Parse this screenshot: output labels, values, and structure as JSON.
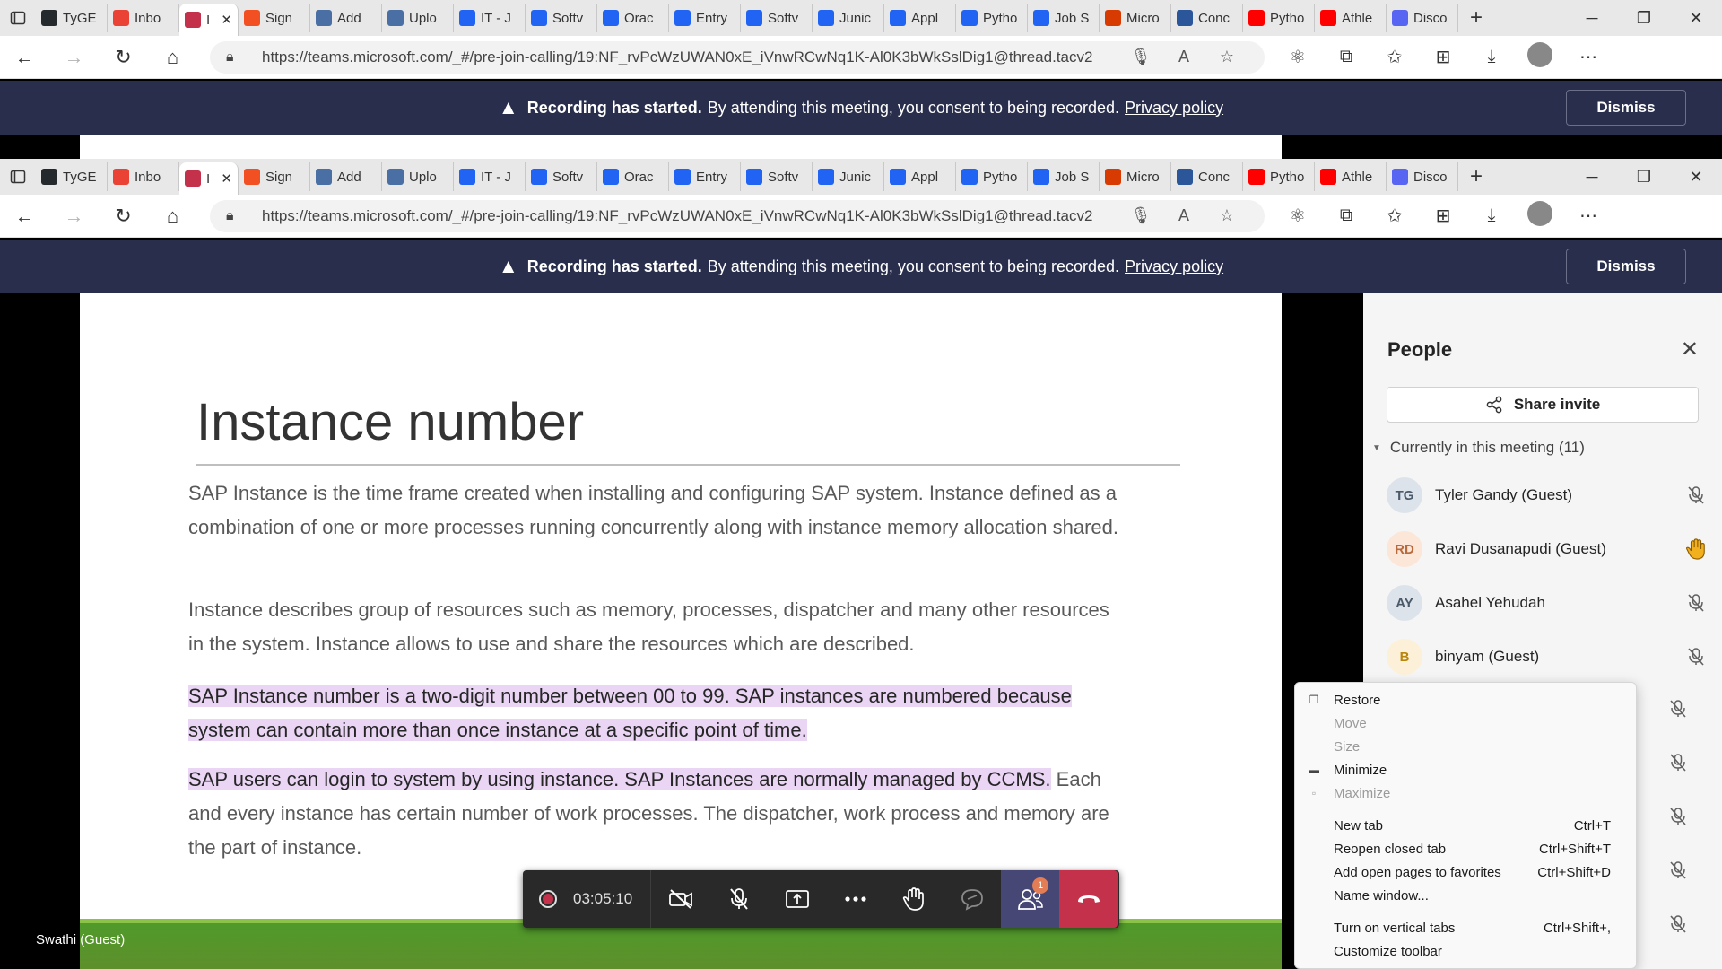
{
  "browser": {
    "tabs": [
      {
        "title": "TyGE",
        "favicon": "github-icon",
        "color": "#24292e"
      },
      {
        "title": "Inbo",
        "favicon": "gmail-icon",
        "color": "#ea4335"
      },
      {
        "title": "I",
        "favicon": "record-icon",
        "color": "#c4314b",
        "active": true
      },
      {
        "title": "Sign",
        "favicon": "microsoft-icon",
        "color": "#f25022"
      },
      {
        "title": "Add",
        "favicon": "page-icon",
        "color": "#4a6fa5"
      },
      {
        "title": "Uplo",
        "favicon": "page-icon",
        "color": "#4a6fa5"
      },
      {
        "title": "IT - J",
        "favicon": "indeed-icon",
        "color": "#2164f3"
      },
      {
        "title": "Softv",
        "favicon": "indeed-icon",
        "color": "#2164f3"
      },
      {
        "title": "Orac",
        "favicon": "indeed-icon",
        "color": "#2164f3"
      },
      {
        "title": "Entry",
        "favicon": "indeed-icon",
        "color": "#2164f3"
      },
      {
        "title": "Softv",
        "favicon": "indeed-icon",
        "color": "#2164f3"
      },
      {
        "title": "Junic",
        "favicon": "indeed-icon",
        "color": "#2164f3"
      },
      {
        "title": "Appl",
        "favicon": "indeed-icon",
        "color": "#2164f3"
      },
      {
        "title": "Pytho",
        "favicon": "indeed-icon",
        "color": "#2164f3"
      },
      {
        "title": "Job S",
        "favicon": "indeed-icon",
        "color": "#2164f3"
      },
      {
        "title": "Micro",
        "favicon": "office-icon",
        "color": "#d83b01"
      },
      {
        "title": "Conc",
        "favicon": "word-icon",
        "color": "#2b579a"
      },
      {
        "title": "Pytho",
        "favicon": "youtube-icon",
        "color": "#ff0000"
      },
      {
        "title": "Athle",
        "favicon": "youtube-icon",
        "color": "#ff0000"
      },
      {
        "title": "Disco",
        "favicon": "discord-icon",
        "color": "#5865f2"
      }
    ],
    "url": "https://teams.microsoft.com/_#/pre-join-calling/19:NF_rvPcWzUWAN0xE_iVnwRCwNq1K-Al0K3bWkSslDig1@thread.tacv2"
  },
  "banner": {
    "bold": "Recording has started.",
    "text": "By attending this meeting, you consent to being recorded.",
    "link": "Privacy policy",
    "dismiss": "Dismiss"
  },
  "slide": {
    "title": "Instance number",
    "p1": "SAP Instance is the time frame created when installing and configuring SAP system. Instance defined as a combination of one or more processes running concurrently along with instance memory allocation shared.",
    "p2": "Instance describes group of resources such as memory, processes, dispatcher and many other resources in the system. Instance allows to use and share the resources which are described.",
    "p3": "SAP Instance number is a two-digit number between 00 to 99. SAP instances are numbered because system can contain more than once instance at a specific point of time.",
    "p4_highlight": "SAP users can login to system by using instance. SAP Instances are normally managed by CCMS.",
    "p4_rest": " Each and every instance has certain number of work processes. The dispatcher, work process and memory are the part of instance."
  },
  "self_label": "Swathi (Guest)",
  "call": {
    "timer": "03:05:10",
    "people_badge": "1"
  },
  "people": {
    "title": "People",
    "share_invite": "Share invite",
    "section": "Currently in this meeting (11)",
    "participants": [
      {
        "initials": "TG",
        "name": "Tyler Gandy (Guest)",
        "bg": "#dde3ea",
        "fg": "#4a5a6a",
        "status": "mic-off-icon"
      },
      {
        "initials": "RD",
        "name": "Ravi Dusanapudi (Guest)",
        "bg": "#fbe6d8",
        "fg": "#b86a3c",
        "status": "raised-hand-icon"
      },
      {
        "initials": "AY",
        "name": "Asahel Yehudah",
        "bg": "#dde3ea",
        "fg": "#4a5a6a",
        "status": "mic-off-icon"
      },
      {
        "initials": "B",
        "name": "binyam (Guest)",
        "bg": "#fdf0d8",
        "fg": "#b8860b",
        "status": "mic-off-icon"
      }
    ]
  },
  "context_menu": {
    "restore": "Restore",
    "move": "Move",
    "size": "Size",
    "minimize": "Minimize",
    "maximize": "Maximize",
    "new_tab": "New tab",
    "new_tab_acc": "Ctrl+T",
    "reopen": "Reopen closed tab",
    "reopen_acc": "Ctrl+Shift+T",
    "add_fav": "Add open pages to favorites",
    "add_fav_acc": "Ctrl+Shift+D",
    "name_window": "Name window...",
    "vertical_tabs": "Turn on vertical tabs",
    "vertical_tabs_acc": "Ctrl+Shift+,",
    "customize": "Customize toolbar"
  }
}
